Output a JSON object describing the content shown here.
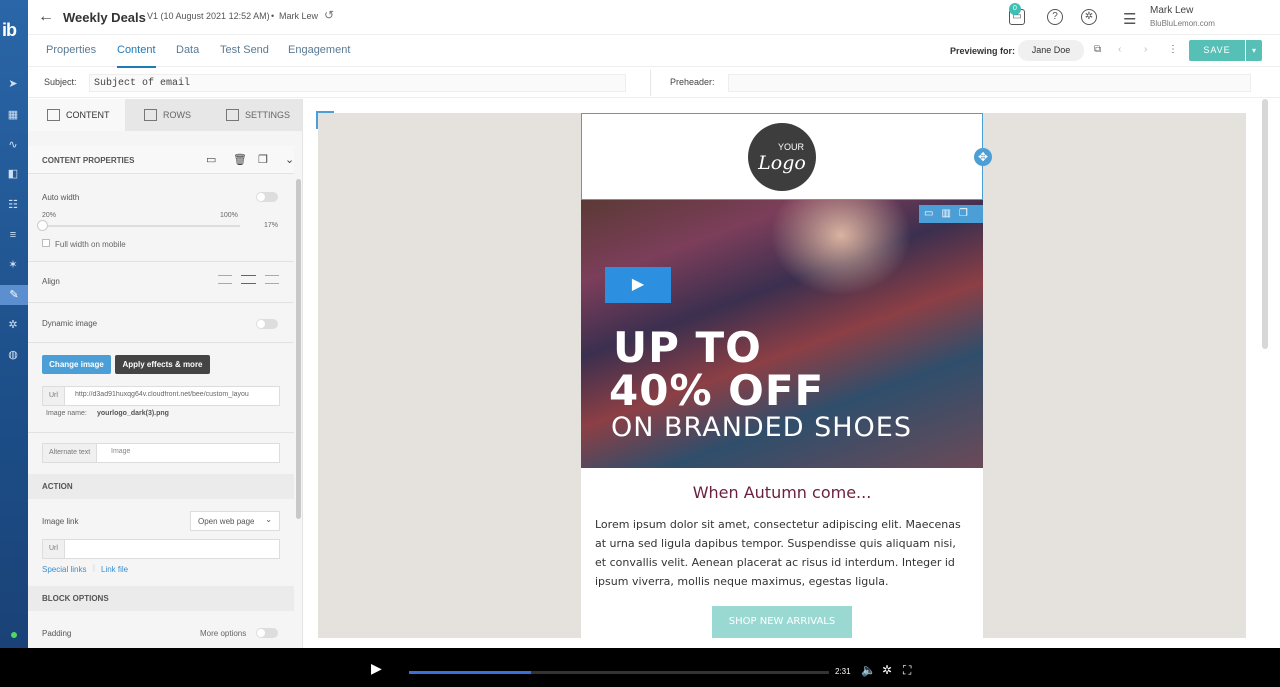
{
  "rail": {
    "brand": "ib",
    "icons": [
      "send-icon",
      "calendar-icon",
      "chart-icon",
      "blocks-icon",
      "team-icon",
      "sliders-icon",
      "wand-icon",
      "brush-icon",
      "gear-icon",
      "globe-icon"
    ]
  },
  "header": {
    "title": "Weekly Deals",
    "version": "V1 (10 August 2021 12:52 AM)",
    "separator": "•",
    "author": "Mark Lew",
    "notification_count": "0",
    "user_name": "Mark Lew",
    "user_org": "BluBluLemon.com"
  },
  "tabs": [
    "Properties",
    "Content",
    "Data",
    "Test Send",
    "Engagement"
  ],
  "active_tab": "Content",
  "preview": {
    "label": "Previewing for:",
    "user": "Jane Doe"
  },
  "save_label": "SAVE",
  "subject": {
    "label": "Subject:",
    "value": "Subject of email"
  },
  "preheader": {
    "label": "Preheader:",
    "value": ""
  },
  "panel": {
    "tabs": [
      "CONTENT",
      "ROWS",
      "SETTINGS"
    ],
    "content_properties": "CONTENT PROPERTIES",
    "auto_width": "Auto width",
    "min_pct": "20%",
    "max_pct": "100%",
    "cur_pct": "17%",
    "width_value": 0.17,
    "full_width_mobile": "Full width on mobile",
    "align": "Align",
    "dynamic_image": "Dynamic image",
    "change_image": "Change image",
    "apply_effects": "Apply effects & more",
    "url_label": "Url",
    "url_value": "http://d3ad91huxqg64v.cloudfront.net/bee/custom_layou",
    "image_name_label": "Image name:",
    "image_name": "yourlogo_dark(3).png",
    "alt_label": "Alternate text",
    "alt_placeholder": "Image",
    "action": "ACTION",
    "image_link": "Image link",
    "image_link_value": "Open web page",
    "url2_label": "Url",
    "special_links": "Special links",
    "link_file": "Link file",
    "block_options": "BLOCK OPTIONS",
    "padding": "Padding",
    "more_options": "More options"
  },
  "email": {
    "logo_your": "YOUR",
    "logo_text": "Logo",
    "hero_line1": "UP TO",
    "hero_line2": "40% OFF",
    "hero_line3": "ON BRANDED SHOES",
    "subtitle": "When Autumn come...",
    "body": "Lorem ipsum dolor sit amet, consectetur adipiscing elit. Maecenas at urna sed ligula dapibus tempor. Suspendisse quis aliquam nisi, et convallis velit. Aenean placerat ac risus id interdum. Integer id ipsum viverra, mollis neque maximus, egestas ligula.",
    "cta": "SHOP NEW ARRIVALS"
  },
  "video": {
    "time": "2:31",
    "progress": 0.29
  },
  "colors": {
    "accent": "#4b9fd6",
    "save": "#56bfb6",
    "rail": "#1d4f89",
    "subtitle": "#6b1f3f",
    "cta": "#9ad9d2"
  }
}
